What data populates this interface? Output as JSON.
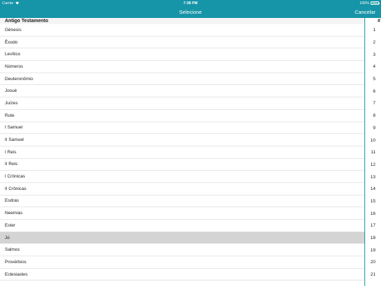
{
  "status_bar": {
    "carrier": "Carrier",
    "time": "7:38 PM",
    "battery": "100%"
  },
  "nav": {
    "title": "Selecione",
    "cancel_label": "Cancelar",
    "bar_color": "#1694a8"
  },
  "section": {
    "title": "Antigo Testamento",
    "index_header": "#"
  },
  "books": [
    {
      "name": "Gênesis",
      "number": "1"
    },
    {
      "name": "Êxodo",
      "number": "2"
    },
    {
      "name": "Levítico",
      "number": "3"
    },
    {
      "name": "Números",
      "number": "4"
    },
    {
      "name": "Deuteronômio",
      "number": "5"
    },
    {
      "name": "Josué",
      "number": "6"
    },
    {
      "name": "Juízes",
      "number": "7"
    },
    {
      "name": "Rute",
      "number": "8"
    },
    {
      "name": "I Samuel",
      "number": "9"
    },
    {
      "name": "II Samuel",
      "number": "10"
    },
    {
      "name": "I Reis",
      "number": "11"
    },
    {
      "name": "II Reis",
      "number": "12"
    },
    {
      "name": "I Crônicas",
      "number": "13"
    },
    {
      "name": "II Crônicas",
      "number": "14"
    },
    {
      "name": "Esdras",
      "number": "15"
    },
    {
      "name": "Neemias",
      "number": "16"
    },
    {
      "name": "Ester",
      "number": "17"
    },
    {
      "name": "Jó",
      "number": "18"
    },
    {
      "name": "Salmos",
      "number": "19"
    },
    {
      "name": "Provérbios",
      "number": "20"
    },
    {
      "name": "Eclesiastes",
      "number": "21"
    }
  ],
  "selected_book": "Jó"
}
